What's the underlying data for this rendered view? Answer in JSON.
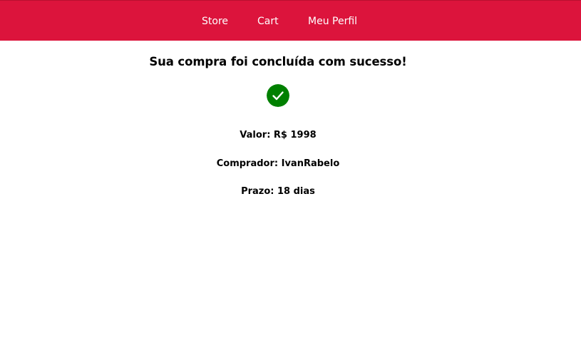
{
  "nav": {
    "store_label": "Store",
    "cart_label": "Cart",
    "profile_label": "Meu Perfil"
  },
  "confirmation": {
    "title": "Sua compra foi concluída com sucesso!",
    "status_icon": "check-circle-icon",
    "value_line": "Valor: R$ 1998",
    "buyer_line": "Comprador: IvanRabelo",
    "deadline_line": "Prazo: 18 dias"
  },
  "colors": {
    "nav_background": "#dc143c",
    "nav_text": "#ffffff",
    "success_icon": "#008000"
  }
}
